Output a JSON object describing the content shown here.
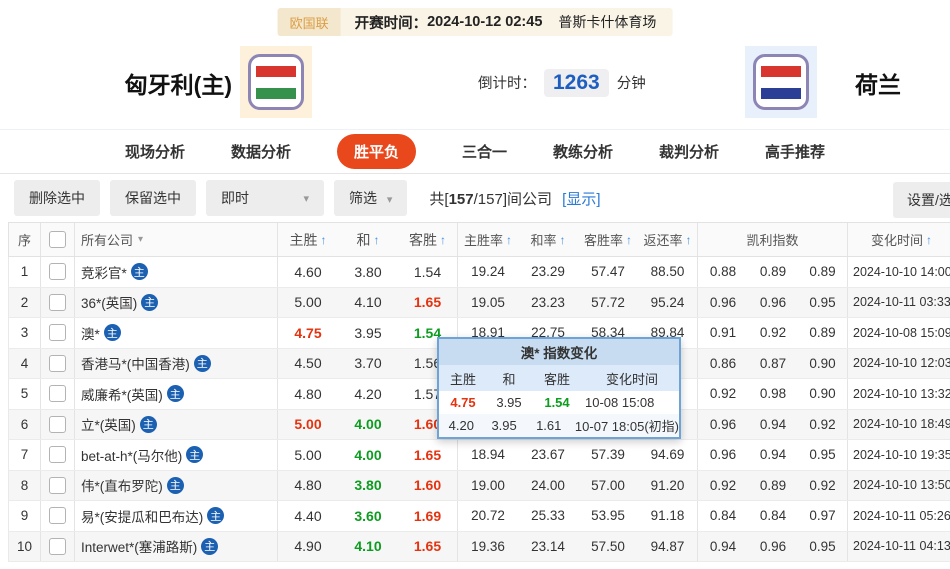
{
  "top_bar": {
    "league": "欧国联",
    "kickoff_label": "开赛时间：",
    "kickoff_time": "2024-10-12 02:45",
    "venue": "普斯卡什体育场"
  },
  "match": {
    "home_name": "匈牙利(主)",
    "away_name": "荷兰",
    "countdown_label": "倒计时：",
    "countdown_value": "1263",
    "countdown_unit": "分钟",
    "home_flag_colors": [
      "#d7352e",
      "#ffffff",
      "#35914c"
    ],
    "away_flag_colors": [
      "#d7352e",
      "#ffffff",
      "#2b3f97"
    ]
  },
  "tabs": [
    {
      "label": "现场分析",
      "active": false
    },
    {
      "label": "数据分析",
      "active": false
    },
    {
      "label": "胜平负",
      "active": true
    },
    {
      "label": "三合一",
      "active": false
    },
    {
      "label": "教练分析",
      "active": false
    },
    {
      "label": "裁判分析",
      "active": false
    },
    {
      "label": "高手推荐",
      "active": false
    }
  ],
  "toolbar": {
    "delete_btn": "删除选中",
    "keep_btn": "保留选中",
    "live_select": "即时",
    "filter_btn": "筛选",
    "caret": "▾",
    "summary_pre": "共[",
    "summary_count": "157",
    "summary_post": "/157]间公司",
    "show_link": "[显示]",
    "settings_btn": "设置/选择"
  },
  "table": {
    "sort_icon": "↑",
    "filter_icon": "▾",
    "badge": "主",
    "headers": {
      "no": "序",
      "company": "所有公司",
      "home": "主胜",
      "draw": "和",
      "away": "客胜",
      "home_rate": "主胜率",
      "draw_rate": "和率",
      "away_rate": "客胜率",
      "payout": "返还率",
      "kelly": "凯利指数",
      "time": "变化时间"
    },
    "rows": [
      {
        "no": "1",
        "company": "竞彩官*",
        "home": {
          "v": "4.60",
          "c": ""
        },
        "draw": {
          "v": "3.80",
          "c": ""
        },
        "away": {
          "v": "1.54",
          "c": ""
        },
        "rates": [
          "19.24",
          "23.29",
          "57.47",
          "88.50"
        ],
        "kelly": [
          "0.88",
          "0.89",
          "0.89"
        ],
        "time": "2024-10-10 14:00"
      },
      {
        "no": "2",
        "company": "36*(英国)",
        "home": {
          "v": "5.00",
          "c": ""
        },
        "draw": {
          "v": "4.10",
          "c": ""
        },
        "away": {
          "v": "1.65",
          "c": "red"
        },
        "rates": [
          "19.05",
          "23.23",
          "57.72",
          "95.24"
        ],
        "kelly": [
          "0.96",
          "0.96",
          "0.95"
        ],
        "time": "2024-10-11 03:33"
      },
      {
        "no": "3",
        "company": "澳*",
        "home": {
          "v": "4.75",
          "c": "red"
        },
        "draw": {
          "v": "3.95",
          "c": ""
        },
        "away": {
          "v": "1.54",
          "c": "green"
        },
        "rates": [
          "18.91",
          "22.75",
          "58.34",
          "89.84"
        ],
        "kelly": [
          "0.91",
          "0.92",
          "0.89"
        ],
        "time": "2024-10-08 15:09"
      },
      {
        "no": "4",
        "company": "香港马*(中国香港)",
        "home": {
          "v": "4.50",
          "c": ""
        },
        "draw": {
          "v": "3.70",
          "c": ""
        },
        "away": {
          "v": "1.56",
          "c": ""
        },
        "rates": [
          "",
          "",
          "",
          ""
        ],
        "kelly": [
          "0.86",
          "0.87",
          "0.90"
        ],
        "time": "2024-10-10 12:03"
      },
      {
        "no": "5",
        "company": "威廉希*(英国)",
        "home": {
          "v": "4.80",
          "c": ""
        },
        "draw": {
          "v": "4.20",
          "c": ""
        },
        "away": {
          "v": "1.57",
          "c": ""
        },
        "rates": [
          "",
          "",
          "",
          ""
        ],
        "kelly": [
          "0.92",
          "0.98",
          "0.90"
        ],
        "time": "2024-10-10 13:32"
      },
      {
        "no": "6",
        "company": "立*(英国)",
        "home": {
          "v": "5.00",
          "c": "red"
        },
        "draw": {
          "v": "4.00",
          "c": "green"
        },
        "away": {
          "v": "1.60",
          "c": "red"
        },
        "rates": [
          "",
          "",
          "",
          ""
        ],
        "kelly": [
          "0.96",
          "0.94",
          "0.92"
        ],
        "time": "2024-10-10 18:49"
      },
      {
        "no": "7",
        "company": "bet-at-h*(马尔他)",
        "home": {
          "v": "5.00",
          "c": ""
        },
        "draw": {
          "v": "4.00",
          "c": "green"
        },
        "away": {
          "v": "1.65",
          "c": "red"
        },
        "rates": [
          "18.94",
          "23.67",
          "57.39",
          "94.69"
        ],
        "kelly": [
          "0.96",
          "0.94",
          "0.95"
        ],
        "time": "2024-10-10 19:35"
      },
      {
        "no": "8",
        "company": "伟*(直布罗陀)",
        "home": {
          "v": "4.80",
          "c": ""
        },
        "draw": {
          "v": "3.80",
          "c": "green"
        },
        "away": {
          "v": "1.60",
          "c": "red"
        },
        "rates": [
          "19.00",
          "24.00",
          "57.00",
          "91.20"
        ],
        "kelly": [
          "0.92",
          "0.89",
          "0.92"
        ],
        "time": "2024-10-10 13:50"
      },
      {
        "no": "9",
        "company": "易*(安提瓜和巴布达)",
        "home": {
          "v": "4.40",
          "c": ""
        },
        "draw": {
          "v": "3.60",
          "c": "green"
        },
        "away": {
          "v": "1.69",
          "c": "red"
        },
        "rates": [
          "20.72",
          "25.33",
          "53.95",
          "91.18"
        ],
        "kelly": [
          "0.84",
          "0.84",
          "0.97"
        ],
        "time": "2024-10-11 05:26"
      },
      {
        "no": "10",
        "company": "Interwet*(塞浦路斯)",
        "home": {
          "v": "4.90",
          "c": ""
        },
        "draw": {
          "v": "4.10",
          "c": "green"
        },
        "away": {
          "v": "1.65",
          "c": "red"
        },
        "rates": [
          "19.36",
          "23.14",
          "57.50",
          "94.87"
        ],
        "kelly": [
          "0.94",
          "0.96",
          "0.95"
        ],
        "time": "2024-10-11 04:13"
      }
    ]
  },
  "tooltip": {
    "title": "澳* 指数变化",
    "headers": [
      "主胜",
      "和",
      "客胜",
      "变化时间"
    ],
    "rows": [
      [
        {
          "v": "4.75",
          "c": "red"
        },
        {
          "v": "3.95",
          "c": ""
        },
        {
          "v": "1.54",
          "c": "green"
        },
        {
          "v": "10-08 15:08",
          "c": ""
        }
      ],
      [
        {
          "v": "4.20",
          "c": ""
        },
        {
          "v": "3.95",
          "c": ""
        },
        {
          "v": "1.61",
          "c": ""
        },
        {
          "v": "10-07 18:05(初指)",
          "c": ""
        }
      ]
    ]
  }
}
